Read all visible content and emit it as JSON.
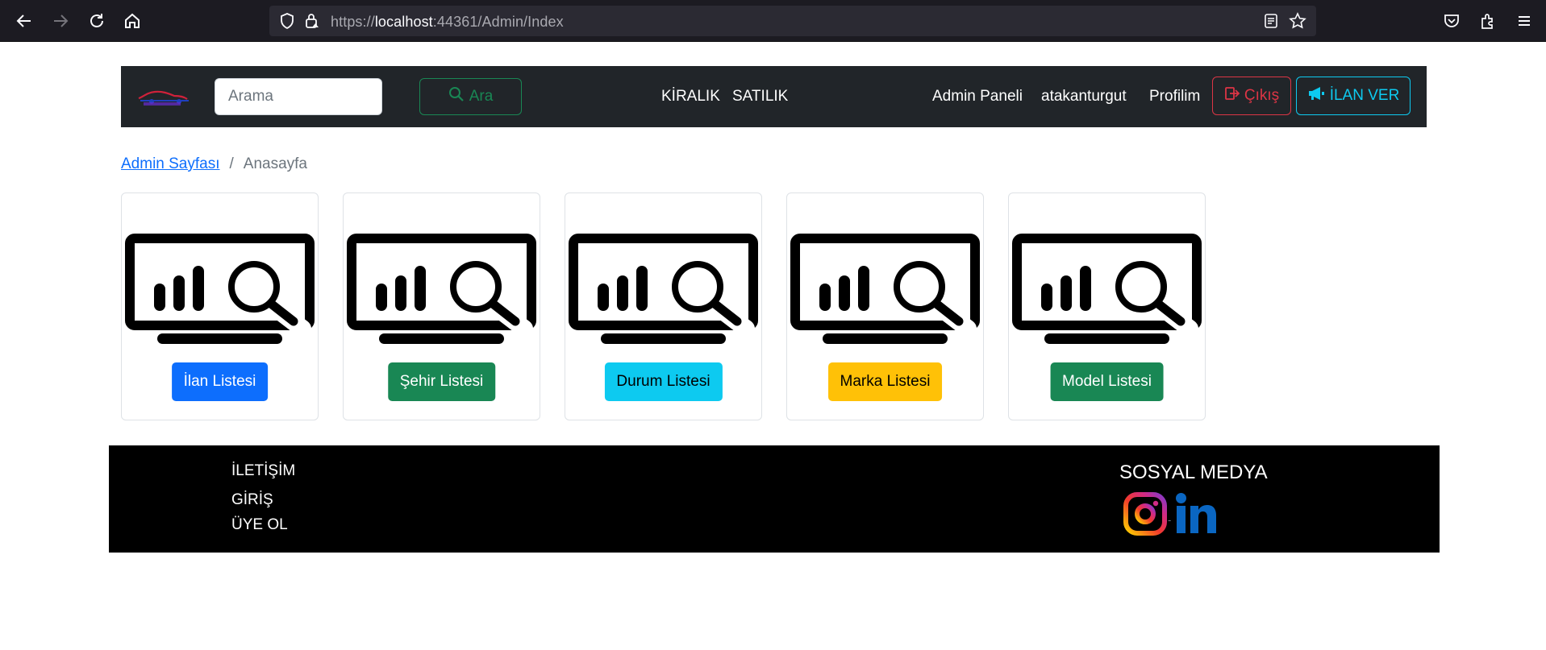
{
  "browser": {
    "url_prefix": "https://",
    "url_host": "localhost",
    "url_rest": ":44361/Admin/Index"
  },
  "navbar": {
    "search_placeholder": "Arama",
    "search_button": "Ara",
    "links": {
      "kiralik": "KİRALIK",
      "satilik": "SATILIK",
      "admin_paneli": "Admin Paneli",
      "username": "atakanturgut",
      "profilim": "Profilim"
    },
    "logout_button": "Çıkış",
    "ilan_ver_button": "İLAN VER"
  },
  "breadcrumb": {
    "root": "Admin Sayfası",
    "separator": "/",
    "current": "Anasayfa"
  },
  "cards": [
    {
      "label": "İlan Listesi",
      "color": "#0d6efd",
      "text_color": "#ffffff"
    },
    {
      "label": "Şehir Listesi",
      "color": "#198754",
      "text_color": "#ffffff"
    },
    {
      "label": "Durum Listesi",
      "color": "#0dcaf0",
      "text_color": "#000000"
    },
    {
      "label": "Marka Listesi",
      "color": "#ffc107",
      "text_color": "#000000"
    },
    {
      "label": "Model Listesi",
      "color": "#198754",
      "text_color": "#ffffff"
    }
  ],
  "footer": {
    "iletisim": "İLETİŞİM",
    "giris": "GİRİŞ",
    "uye_ol": "ÜYE OL",
    "sosyal_medya": "SOSYAL MEDYA",
    "social_icons": [
      "instagram-icon",
      "linkedin-icon"
    ]
  }
}
